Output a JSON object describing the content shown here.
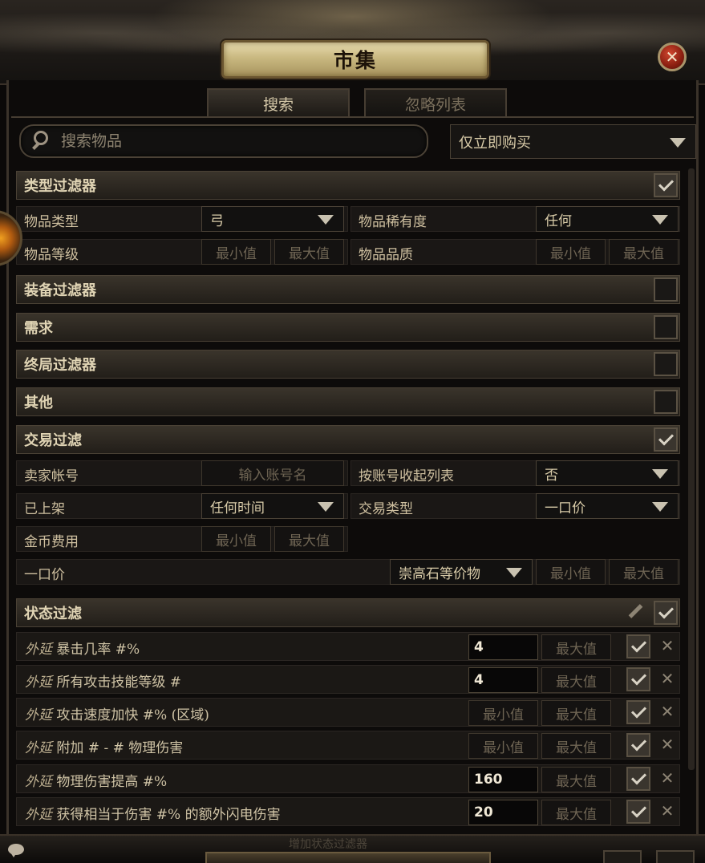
{
  "window": {
    "title": "市集"
  },
  "tabs": [
    {
      "label": "搜索",
      "active": true
    },
    {
      "label": "忽略列表",
      "active": false
    }
  ],
  "search": {
    "placeholder": "搜索物品",
    "value": ""
  },
  "buy_filter": {
    "selected": "仅立即购买"
  },
  "sections": {
    "type_filters": {
      "title": "类型过滤器",
      "checked": true
    },
    "equipment_filters": {
      "title": "装备过滤器",
      "checked": false
    },
    "requirements": {
      "title": "需求",
      "checked": false
    },
    "endgame_filters": {
      "title": "终局过滤器",
      "checked": false
    },
    "misc": {
      "title": "其他",
      "checked": false
    },
    "trade_filters": {
      "title": "交易过滤",
      "checked": true
    },
    "stat_filters": {
      "title": "状态过滤",
      "checked": true
    }
  },
  "type_filters": {
    "item_type_label": "物品类型",
    "item_type_value": "弓",
    "rarity_label": "物品稀有度",
    "rarity_value": "任何",
    "item_level_label": "物品等级",
    "quality_label": "物品品质"
  },
  "common": {
    "min": "最小值",
    "max": "最大值"
  },
  "trade_filters": {
    "seller_label": "卖家帐号",
    "seller_placeholder": "输入账号名",
    "collapse_label": "按账号收起列表",
    "collapse_value": "否",
    "listed_label": "已上架",
    "listed_value": "任何时间",
    "sale_type_label": "交易类型",
    "sale_type_value": "一口价",
    "gold_label": "金币费用",
    "price_label": "一口价",
    "price_currency": "崇高石等价物"
  },
  "stats": [
    {
      "tag": "外延",
      "text": "暴击几率 #%",
      "min": "4",
      "max": "",
      "checked": true
    },
    {
      "tag": "外延",
      "text": "所有攻击技能等级 #",
      "min": "4",
      "max": "",
      "checked": true
    },
    {
      "tag": "外延",
      "text": "攻击速度加快 #% (区域)",
      "min": "",
      "max": "",
      "checked": true
    },
    {
      "tag": "外延",
      "text": "附加 # - # 物理伤害",
      "min": "",
      "max": "",
      "checked": true
    },
    {
      "tag": "外延",
      "text": "物理伤害提高 #%",
      "min": "160",
      "max": "",
      "checked": true
    },
    {
      "tag": "外延",
      "text": "获得相当于伤害 #% 的额外闪电伤害",
      "min": "20",
      "max": "",
      "checked": true
    }
  ],
  "footer": {
    "ghost_text": "增加状态过滤器"
  }
}
